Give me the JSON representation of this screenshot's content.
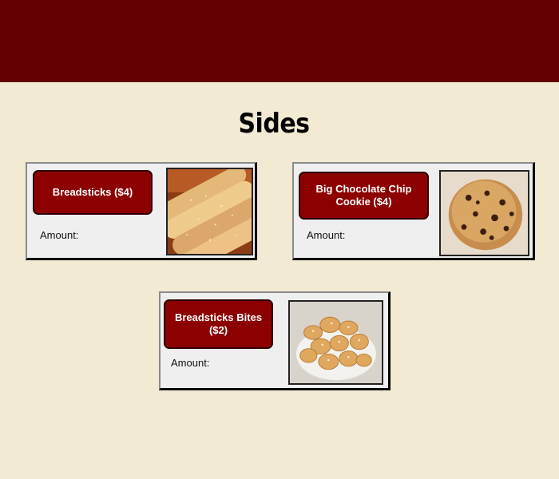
{
  "section": {
    "title": "Sides"
  },
  "items": [
    {
      "label": "Breadsticks ($4)",
      "amount_label": "Amount:",
      "photo": "breadsticks-photo"
    },
    {
      "label": "Big Chocolate Chip Cookie ($4)",
      "amount_label": "Amount:",
      "photo": "cookie-photo"
    },
    {
      "label": "Breadsticks Bites ($2)",
      "amount_label": "Amount:",
      "photo": "breadstick-bites-photo"
    }
  ],
  "colors": {
    "header": "#650000",
    "background": "#f2ead3",
    "button": "#8d0000",
    "card": "#efefef"
  }
}
